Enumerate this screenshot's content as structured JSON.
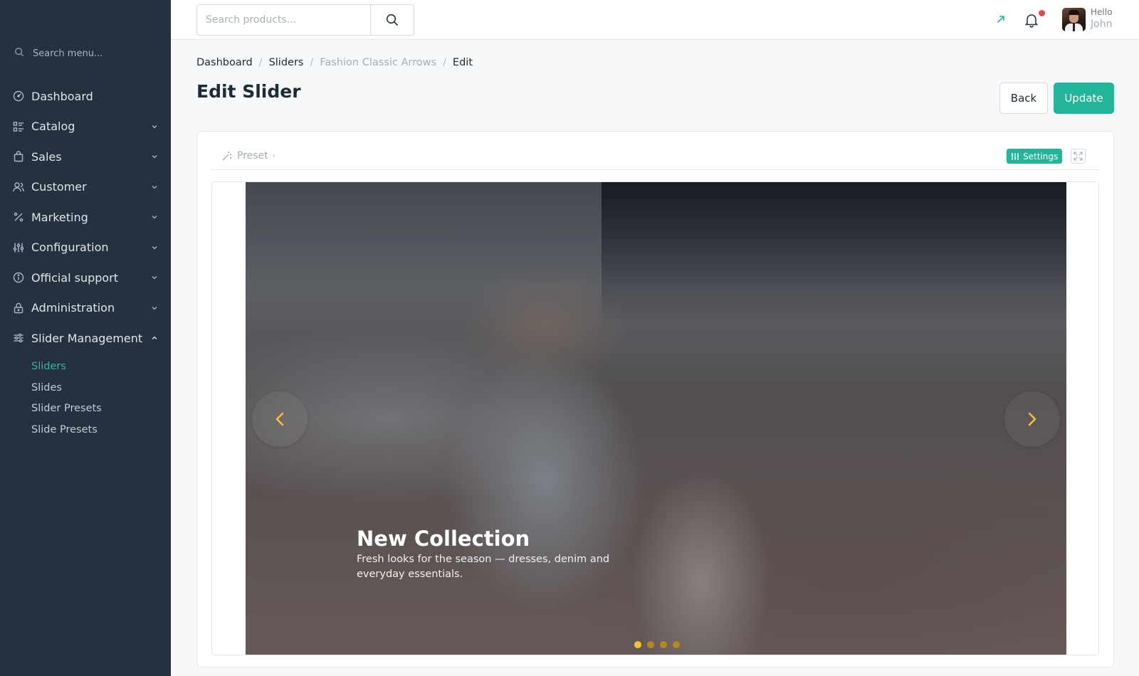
{
  "sidebar": {
    "search_placeholder": "Search menu...",
    "items": [
      {
        "label": "Dashboard",
        "icon": "dashboard-icon",
        "expandable": false
      },
      {
        "label": "Catalog",
        "icon": "catalog-icon",
        "expandable": true
      },
      {
        "label": "Sales",
        "icon": "shopping-bag-icon",
        "expandable": true
      },
      {
        "label": "Customer",
        "icon": "users-icon",
        "expandable": true
      },
      {
        "label": "Marketing",
        "icon": "percent-icon",
        "expandable": true
      },
      {
        "label": "Configuration",
        "icon": "sliders-icon",
        "expandable": true
      },
      {
        "label": "Official support",
        "icon": "info-icon",
        "expandable": true
      },
      {
        "label": "Administration",
        "icon": "lock-icon",
        "expandable": true
      },
      {
        "label": "Slider Management",
        "icon": "slider-settings-icon",
        "expandable": true,
        "expanded": true
      }
    ],
    "subitems": [
      {
        "label": "Sliders",
        "active": true
      },
      {
        "label": "Slides",
        "active": false
      },
      {
        "label": "Slider Presets",
        "active": false
      },
      {
        "label": "Slide Presets",
        "active": false
      }
    ]
  },
  "topbar": {
    "search_placeholder": "Search products...",
    "user_greeting": "Hello",
    "user_name": "John",
    "accent": "#22b59a",
    "notification_dot_color": "#e5484d"
  },
  "breadcrumb": [
    "Dashboard",
    "Sliders",
    "Fashion Classic Arrows",
    "Edit"
  ],
  "page": {
    "title": "Edit Slider",
    "back_label": "Back",
    "update_label": "Update"
  },
  "editor": {
    "preset_label": "Preset",
    "settings_label": "Settings"
  },
  "slide": {
    "title": "New Collection",
    "description": "Fresh looks for the season — dresses, denim and everyday essentials.",
    "arrow_color": "#f2c232",
    "dot_count": 4,
    "active_dot": 0
  }
}
